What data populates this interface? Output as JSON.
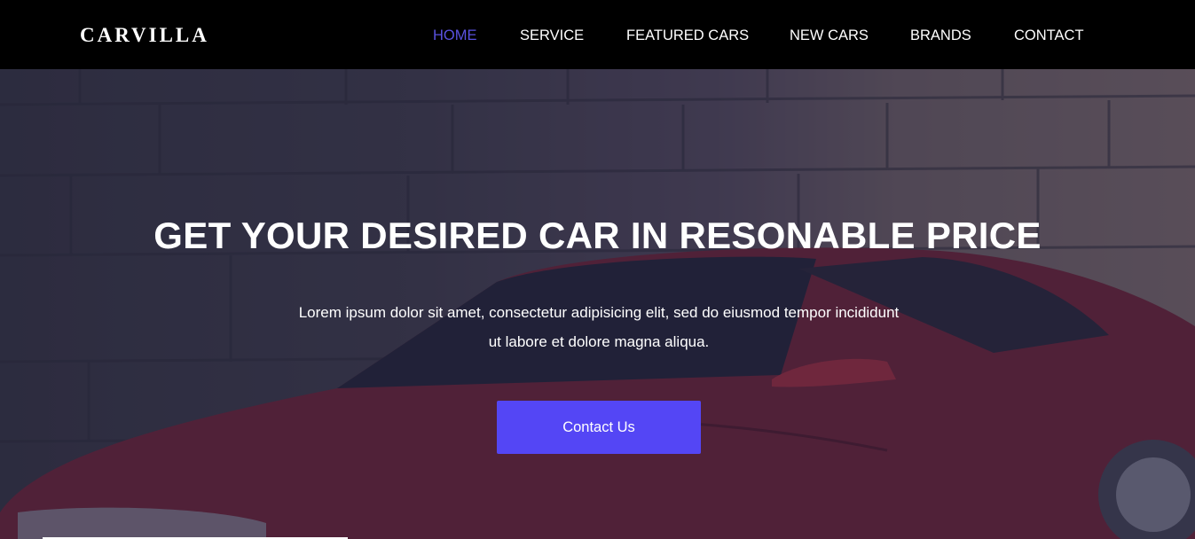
{
  "brand": {
    "logo_text": "CARVILLA"
  },
  "nav": {
    "items": [
      {
        "label": "HOME",
        "active": true
      },
      {
        "label": "SERVICE",
        "active": false
      },
      {
        "label": "FEATURED CARS",
        "active": false
      },
      {
        "label": "NEW CARS",
        "active": false
      },
      {
        "label": "BRANDS",
        "active": false
      },
      {
        "label": "CONTACT",
        "active": false
      }
    ],
    "active_color": "#5a52e0"
  },
  "hero": {
    "title": "GET YOUR DESIRED CAR IN RESONABLE PRICE",
    "text_line1": "Lorem ipsum dolor sit amet, consectetur adipisicing elit, sed do eiusmod tempor incididunt",
    "text_line2": "ut labore et dolore magna aliqua.",
    "cta_label": "Contact Us",
    "cta_color": "#5446f5"
  }
}
